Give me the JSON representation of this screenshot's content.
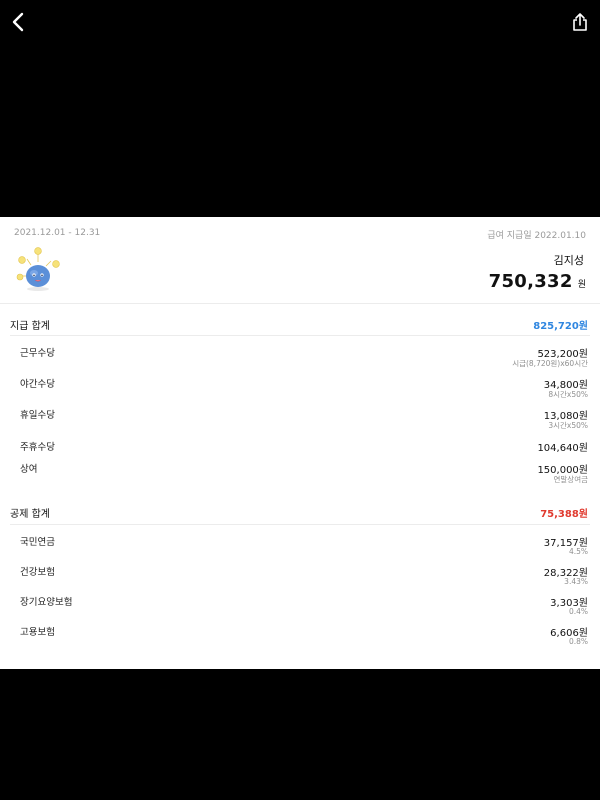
{
  "header": {
    "period": "2021.12.01 - 12.31",
    "pay_date": "급여 지급일 2022.01.10"
  },
  "employee": {
    "name": "김지성",
    "net_pay": "750,332",
    "net_pay_unit": "원"
  },
  "payments": {
    "title": "지급 합계",
    "total": "825,720원",
    "items": [
      {
        "label": "근무수당",
        "value": "523,200원",
        "detail": "시급(8,720원)x60시간"
      },
      {
        "label": "야간수당",
        "value": "34,800원",
        "detail": "8시간x50%"
      },
      {
        "label": "휴일수당",
        "value": "13,080원",
        "detail": "3시간x50%"
      },
      {
        "label": "주휴수당",
        "value": "104,640원",
        "detail": ""
      },
      {
        "label": "상여",
        "value": "150,000원",
        "detail": "연말상여금"
      }
    ]
  },
  "deductions": {
    "title": "공제 합계",
    "total": "75,388원",
    "items": [
      {
        "label": "국민연금",
        "value": "37,157원",
        "detail": "4.5%"
      },
      {
        "label": "건강보험",
        "value": "28,322원",
        "detail": "3.43%"
      },
      {
        "label": "장기요양보험",
        "value": "3,303원",
        "detail": "0.4%"
      },
      {
        "label": "고용보험",
        "value": "6,606원",
        "detail": "0.8%"
      }
    ]
  },
  "icons": {
    "back": "chevron-left-icon",
    "share": "share-icon",
    "mascot": "coin-character-illustration"
  },
  "colors": {
    "payment_total": "#2f86e0",
    "deduction_total": "#e03a2f"
  }
}
